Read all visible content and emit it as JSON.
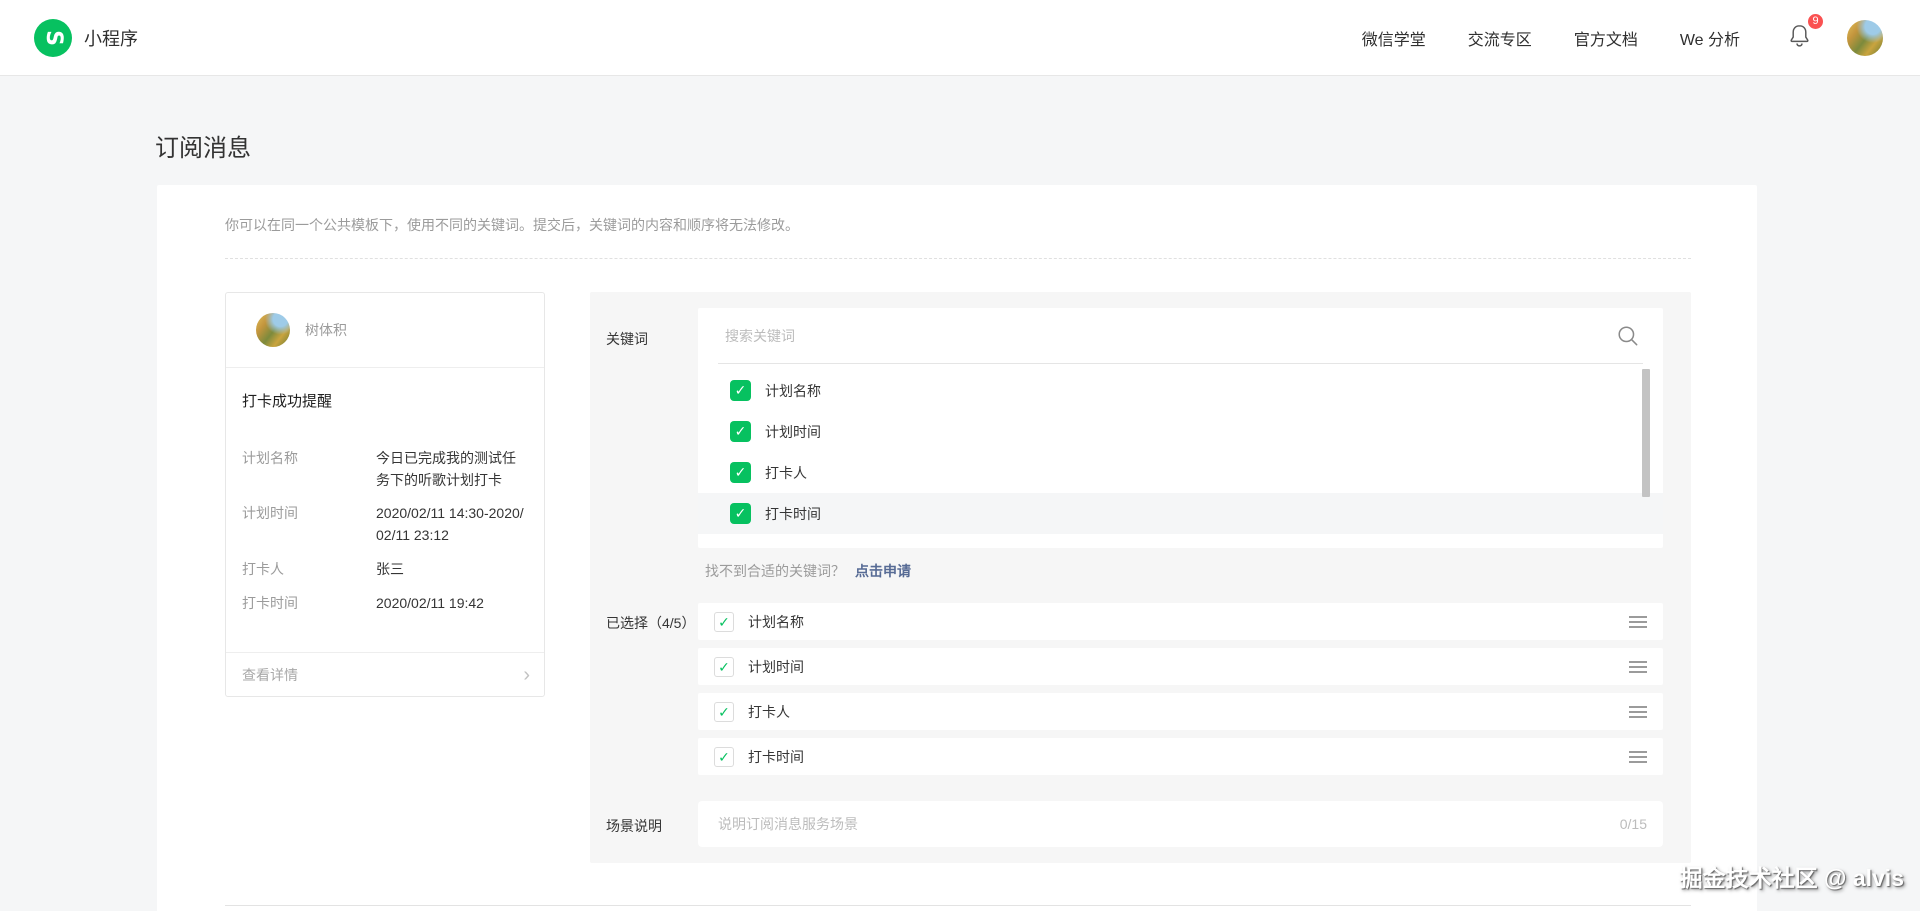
{
  "navbar": {
    "logo_text": "小程序",
    "links": [
      {
        "label": "微信学堂"
      },
      {
        "label": "交流专区"
      },
      {
        "label": "官方文档"
      },
      {
        "label": "We 分析"
      }
    ],
    "notification_count": "9"
  },
  "page": {
    "title": "订阅消息",
    "description": "你可以在同一个公共模板下，使用不同的关键词。提交后，关键词的内容和顺序将无法修改。"
  },
  "preview_card": {
    "account_name": "树体积",
    "message_title": "打卡成功提醒",
    "fields": [
      {
        "label": "计划名称",
        "value": "今日已完成我的测试任务下的听歌计划打卡"
      },
      {
        "label": "计划时间",
        "value": "2020/02/11 14:30-2020/02/11 23:12"
      },
      {
        "label": "打卡人",
        "value": "张三"
      },
      {
        "label": "打卡时间",
        "value": "2020/02/11 19:42"
      }
    ],
    "detail_link": "查看详情",
    "chevron": "›"
  },
  "keyword_section": {
    "label": "关键词",
    "search_placeholder": "搜索关键词",
    "options": [
      {
        "label": "计划名称",
        "checked": true
      },
      {
        "label": "计划时间",
        "checked": true
      },
      {
        "label": "打卡人",
        "checked": true
      },
      {
        "label": "打卡时间",
        "checked": true
      }
    ],
    "apply_hint": "找不到合适的关键词？",
    "apply_link": "点击申请"
  },
  "selected_section": {
    "label": "已选择（4/5）",
    "items": [
      {
        "label": "计划名称"
      },
      {
        "label": "计划时间"
      },
      {
        "label": "打卡人"
      },
      {
        "label": "打卡时间"
      }
    ]
  },
  "scene_section": {
    "label": "场景说明",
    "placeholder": "说明订阅消息服务场景",
    "counter": "0/15"
  },
  "watermark": "掘金技术社区 @ alvis",
  "icons": {
    "check": "✓",
    "logo_glyph": "S"
  },
  "colors": {
    "brand_green": "#07c160",
    "badge_red": "#fa5151",
    "link_blue": "#576b95",
    "panel_gray": "#f6f6f6"
  }
}
